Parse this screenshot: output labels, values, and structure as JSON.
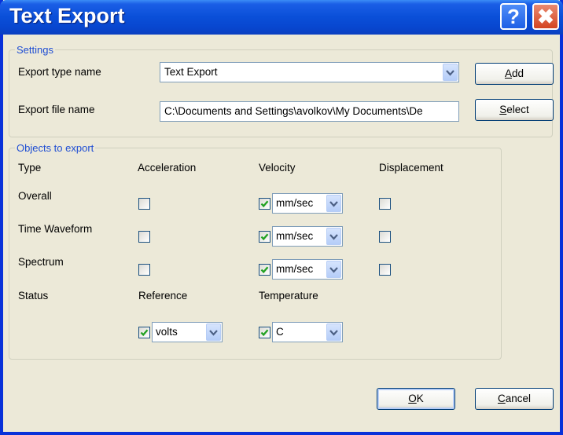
{
  "window": {
    "title": "Text Export",
    "help_glyph": "?",
    "close_glyph": "✖"
  },
  "settings": {
    "legend": "Settings",
    "export_type_label": "Export type name",
    "export_type_value": "Text Export",
    "export_file_label": "Export file name",
    "export_file_value": "C:\\Documents and Settings\\avolkov\\My Documents\\De",
    "add_button": {
      "mnemonic": "A",
      "rest": "dd"
    },
    "select_button": {
      "mnemonic": "S",
      "rest": "elect"
    }
  },
  "objects": {
    "legend": "Objects to export",
    "headers": {
      "type": "Type",
      "acceleration": "Acceleration",
      "velocity": "Velocity",
      "displacement": "Displacement"
    },
    "rows": [
      {
        "label": "Overall",
        "acceleration_checked": false,
        "velocity_checked": true,
        "velocity_unit": "mm/sec",
        "displacement_checked": false
      },
      {
        "label": "Time Waveform",
        "acceleration_checked": false,
        "velocity_checked": true,
        "velocity_unit": "mm/sec",
        "displacement_checked": false
      },
      {
        "label": "Spectrum",
        "acceleration_checked": false,
        "velocity_checked": true,
        "velocity_unit": "mm/sec",
        "displacement_checked": false
      }
    ],
    "status": {
      "label": "Status",
      "reference_label": "Reference",
      "reference_checked": true,
      "reference_unit": "volts",
      "temperature_label": "Temperature",
      "temperature_checked": true,
      "temperature_unit": "C"
    }
  },
  "footer": {
    "ok_button": {
      "mnemonic": "O",
      "rest": "K"
    },
    "cancel_button": {
      "mnemonic": "C",
      "rest": "ancel"
    }
  }
}
